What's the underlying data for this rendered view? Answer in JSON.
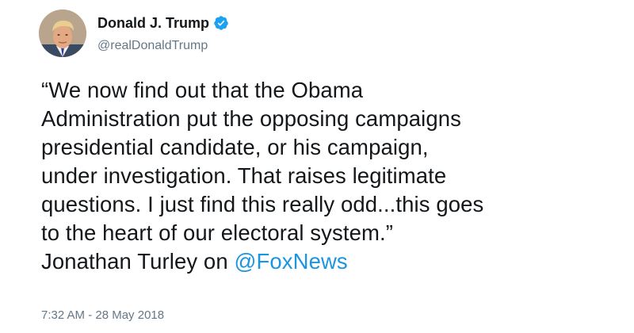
{
  "user": {
    "display_name": "Donald J. Trump",
    "handle": "@realDonaldTrump",
    "verified": true,
    "avatar_icon": "profile-photo",
    "verified_icon": "verified-badge-icon",
    "verified_color": "#1da1f2"
  },
  "tweet": {
    "lines": [
      "“We now find out that the Obama",
      "Administration put the opposing campaigns",
      "presidential candidate, or his campaign,",
      "under investigation. That raises legitimate",
      "questions. I just find this really odd...this goes",
      "to the heart of our electoral system.”"
    ],
    "last_line_prefix": "Jonathan Turley on ",
    "mention": "@FoxNews",
    "mention_color": "#1b95e0",
    "timestamp": "7:32 AM - 28 May 2018"
  }
}
